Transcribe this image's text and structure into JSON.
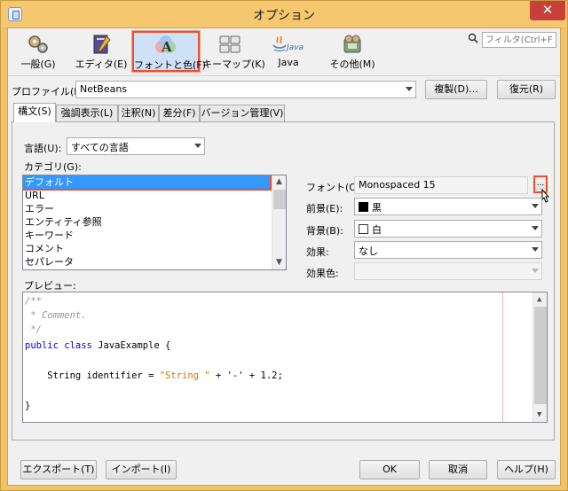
{
  "window": {
    "title": "オプション",
    "close_glyph": "✕"
  },
  "toolbar": {
    "categories": [
      {
        "label": "一般(G)",
        "icon": "general-icon"
      },
      {
        "label": "エディタ(E)",
        "icon": "editor-icon"
      },
      {
        "label": "フォントと色(F)",
        "icon": "fonts-colors-icon",
        "selected": true
      },
      {
        "label": "キーマップ(K)",
        "icon": "keymap-icon"
      },
      {
        "label": "Java",
        "icon": "java-icon"
      },
      {
        "label": "その他(M)",
        "icon": "misc-icon"
      }
    ],
    "java_logo_text": "Java",
    "search_placeholder": "フィルタ(Ctrl+F)"
  },
  "profile": {
    "label": "プロファイル(P):",
    "value": "NetBeans",
    "duplicate_button": "複製(D)...",
    "restore_button": "復元(R)"
  },
  "tabs": [
    {
      "label": "構文(S)",
      "active": true
    },
    {
      "label": "強調表示(L)"
    },
    {
      "label": "注釈(N)"
    },
    {
      "label": "差分(F)"
    },
    {
      "label": "バージョン管理(V)"
    }
  ],
  "syntax": {
    "language_label": "言語(U):",
    "language_value": "すべての言語",
    "category_label": "カテゴリ(G):",
    "categories": [
      "デフォルト",
      "URL",
      "エラー",
      "エンティティ参照",
      "キーワード",
      "コメント",
      "セパレータ"
    ],
    "font_label": "フォント(O):",
    "font_value": "Monospaced 15",
    "font_button": "...",
    "foreground_label": "前景(E):",
    "foreground_value": "黒",
    "foreground_color": "#000000",
    "background_label": "背景(B):",
    "background_value": "白",
    "background_color": "#ffffff",
    "effect_label": "効果:",
    "effect_value": "なし",
    "effect_color_label": "効果色:",
    "effect_color_value": "",
    "preview_label": "プレビュー:"
  },
  "preview_code": {
    "line1": "/**",
    "line2": " * Comment.",
    "line3": " */",
    "line4_kw": "public class",
    "line4_rest": " JavaExample {",
    "line5_pre": "    String identifier = ",
    "line5_str": "\"String \"",
    "line5_post": " + '-' + 1.2;",
    "line6": "}"
  },
  "footer": {
    "export_button": "エクスポート(T)",
    "import_button": "インポート(I)",
    "ok_button": "OK",
    "cancel_button": "取消",
    "help_button": "ヘルプ(H)"
  }
}
